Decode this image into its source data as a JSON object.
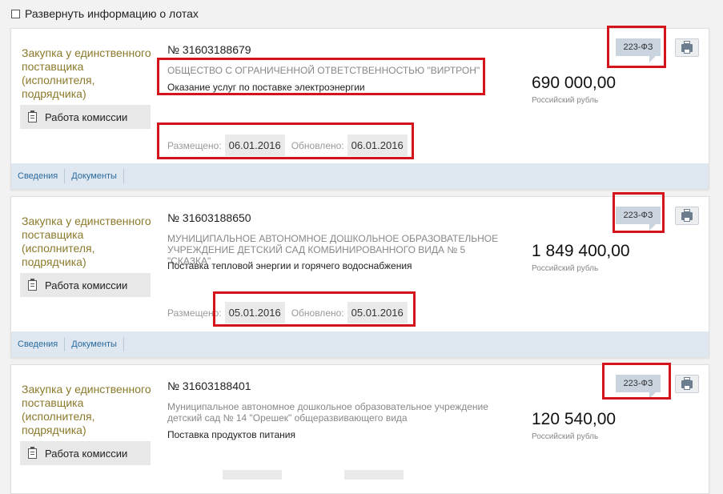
{
  "top": {
    "expand_label": "Развернуть информацию о лотах",
    "checked": false
  },
  "lots": [
    {
      "type": "Закупка у единственного поставщика (исполнителя, подрядчика)",
      "commission_label": "Работа комиссии",
      "number": "№ 31603188679",
      "org": "ОБЩЕСТВО С ОГРАНИЧЕННОЙ ОТВЕТСТВЕННОСТЬЮ \"ВИРТРОН\"",
      "subject": "Оказание услуг по поставке электроэнергии",
      "posted_label": "Размещено:",
      "posted": "06.01.2016",
      "updated_label": "Обновлено:",
      "updated": "06.01.2016",
      "price": "690 000,00",
      "currency": "Российский рубль",
      "law": "223-ФЗ",
      "tabs": [
        "Сведения",
        "Документы"
      ]
    },
    {
      "type": "Закупка у единственного поставщика (исполнителя, подрядчика)",
      "commission_label": "Работа комиссии",
      "number": "№ 31603188650",
      "org": "МУНИЦИПАЛЬНОЕ АВТОНОМНОЕ ДОШКОЛЬНОЕ ОБРАЗОВАТЕЛЬНОЕ УЧРЕЖДЕНИЕ ДЕТСКИЙ САД КОМБИНИРОВАННОГО ВИДА № 5 \"СКАЗКА\"",
      "subject": "Поставка тепловой энергии и горячего водоснабжения",
      "posted_label": "Размещено:",
      "posted": "05.01.2016",
      "updated_label": "Обновлено:",
      "updated": "05.01.2016",
      "price": "1 849 400,00",
      "currency": "Российский рубль",
      "law": "223-ФЗ",
      "tabs": [
        "Сведения",
        "Документы"
      ]
    },
    {
      "type": "Закупка у единственного поставщика (исполнителя, подрядчика)",
      "commission_label": "Работа комиссии",
      "number": "№ 31603188401",
      "org": "Муниципальное автономное дошкольное образовательное учреждение детский сад № 14 \"Орешек\" общеразвивающего вида",
      "subject": "Поставка продуктов питания",
      "price": "120 540,00",
      "currency": "Российский рубль",
      "law": "223-ФЗ"
    }
  ]
}
